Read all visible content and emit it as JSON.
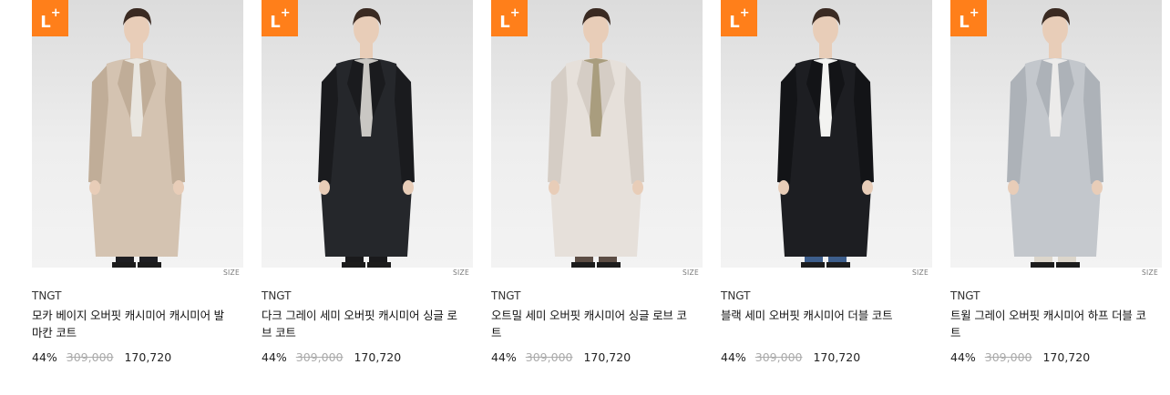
{
  "products": [
    {
      "badge": "L",
      "size_label": "SIZE",
      "brand": "TNGT",
      "title": "모카 베이지 오버핏 캐시미어 캐시미어 발마칸 코트",
      "discount": "44%",
      "original_price": "309,000",
      "sale_price": "170,720",
      "coat_color": "#d4c3b1",
      "coat_shade": "#c0ad98",
      "inner_color": "#e9e6e0",
      "pants_color": "#1e1e22"
    },
    {
      "badge": "L",
      "size_label": "SIZE",
      "brand": "TNGT",
      "title": "다크 그레이 세미 오버핏 캐시미어 싱글 로브 코트",
      "discount": "44%",
      "original_price": "309,000",
      "sale_price": "170,720",
      "coat_color": "#25272b",
      "coat_shade": "#1a1b1e",
      "inner_color": "#c9c7c3",
      "pants_color": "#1a1a1c"
    },
    {
      "badge": "L",
      "size_label": "SIZE",
      "brand": "TNGT",
      "title": "오트밀 세미 오버핏 캐시미어 싱글 로브 코트",
      "discount": "44%",
      "original_price": "309,000",
      "sale_price": "170,720",
      "coat_color": "#e6e0da",
      "coat_shade": "#d5cdc5",
      "inner_color": "#a99d7e",
      "pants_color": "#5c4d44"
    },
    {
      "badge": "L",
      "size_label": "SIZE",
      "brand": "TNGT",
      "title": "블랙 세미 오버핏 캐시미어 더블 코트",
      "discount": "44%",
      "original_price": "309,000",
      "sale_price": "170,720",
      "coat_color": "#1d1e22",
      "coat_shade": "#131417",
      "inner_color": "#f3f3f1",
      "pants_color": "#3d5e8c"
    },
    {
      "badge": "L",
      "size_label": "SIZE",
      "brand": "TNGT",
      "title": "트윌 그레이 오버핏 캐시미어 하프 더블 코트",
      "discount": "44%",
      "original_price": "309,000",
      "sale_price": "170,720",
      "coat_color": "#c3c7cc",
      "coat_shade": "#adb2b8",
      "inner_color": "#ecebea",
      "pants_color": "#dcd6cb"
    }
  ],
  "colors": {
    "badge_bg": "#ff7f1a",
    "strike_price": "#aaaaaa"
  }
}
